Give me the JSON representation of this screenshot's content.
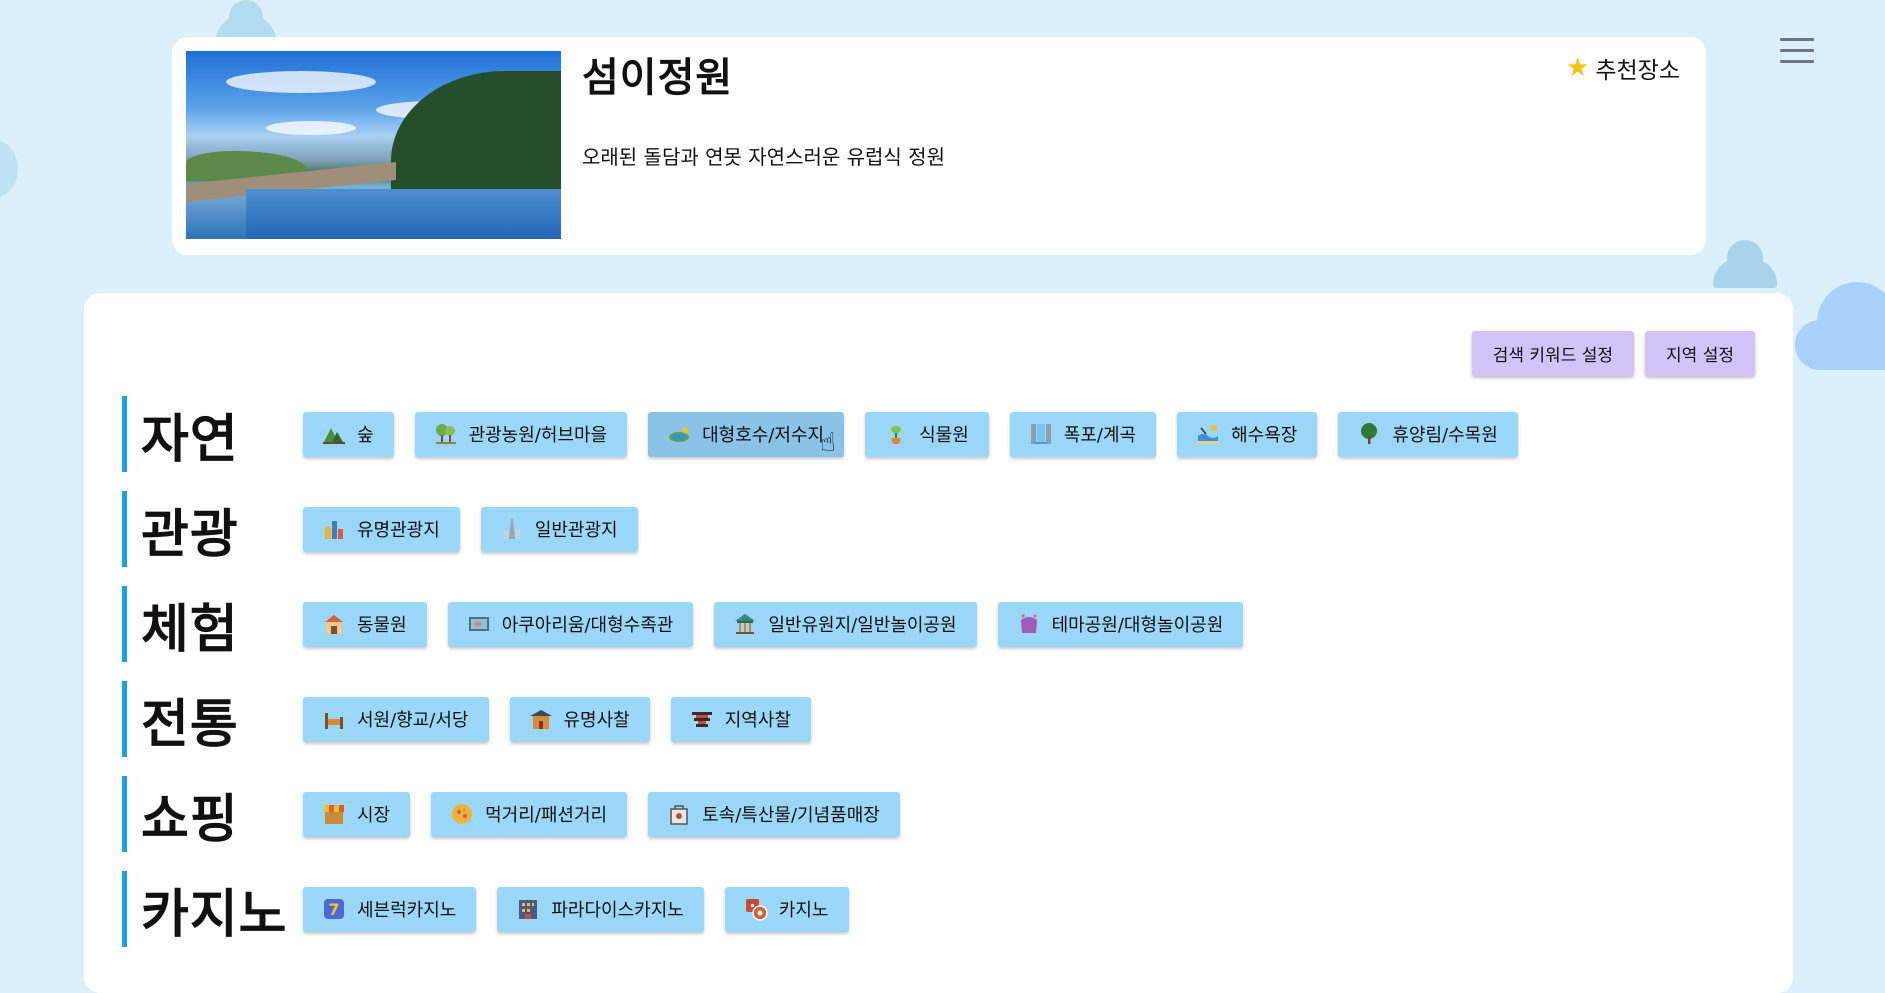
{
  "place": {
    "title": "섬이정원",
    "description": "오래된 돌담과 연못 자연스러운 유럽식 정원",
    "recommend_label": "추천장소"
  },
  "top_buttons": {
    "keyword": "검색 키워드 설정",
    "region": "지역 설정"
  },
  "categories": [
    {
      "title": "자연",
      "items": [
        {
          "label": "숲",
          "icon": "forest-icon"
        },
        {
          "label": "관광농원/허브마을",
          "icon": "farm-icon"
        },
        {
          "label": "대형호수/저수지",
          "icon": "lake-icon"
        },
        {
          "label": "식물원",
          "icon": "plant-icon"
        },
        {
          "label": "폭포/계곡",
          "icon": "waterfall-icon"
        },
        {
          "label": "해수욕장",
          "icon": "beach-icon"
        },
        {
          "label": "휴양림/수목원",
          "icon": "tree-icon"
        }
      ]
    },
    {
      "title": "관광",
      "items": [
        {
          "label": "유명관광지",
          "icon": "landmark-icon"
        },
        {
          "label": "일반관광지",
          "icon": "tower-icon"
        }
      ]
    },
    {
      "title": "체험",
      "items": [
        {
          "label": "동물원",
          "icon": "zoo-icon"
        },
        {
          "label": "아쿠아리움/대형수족관",
          "icon": "aquarium-icon"
        },
        {
          "label": "일반유원지/일반놀이공원",
          "icon": "carousel-icon"
        },
        {
          "label": "테마공원/대형놀이공원",
          "icon": "theme-park-icon"
        }
      ]
    },
    {
      "title": "전통",
      "items": [
        {
          "label": "서원/향교/서당",
          "icon": "school-icon"
        },
        {
          "label": "유명사찰",
          "icon": "temple-icon"
        },
        {
          "label": "지역사찰",
          "icon": "pagoda-icon"
        }
      ]
    },
    {
      "title": "쇼핑",
      "items": [
        {
          "label": "시장",
          "icon": "market-icon"
        },
        {
          "label": "먹거리/패션거리",
          "icon": "food-icon"
        },
        {
          "label": "토속/특산물/기념품매장",
          "icon": "souvenir-icon"
        }
      ]
    },
    {
      "title": "카지노",
      "items": [
        {
          "label": "세븐럭카지노",
          "icon": "slot-icon"
        },
        {
          "label": "파라다이스카지노",
          "icon": "casino-building-icon"
        },
        {
          "label": "카지노",
          "icon": "dice-icon"
        }
      ]
    }
  ],
  "colors": {
    "background": "#dcf0fc",
    "chip": "#9bd7f8",
    "chip_active": "#8ac3e6",
    "top_button": "#d3c3fb",
    "category_bar": "#1f9fe6",
    "star": "#f2c318"
  }
}
